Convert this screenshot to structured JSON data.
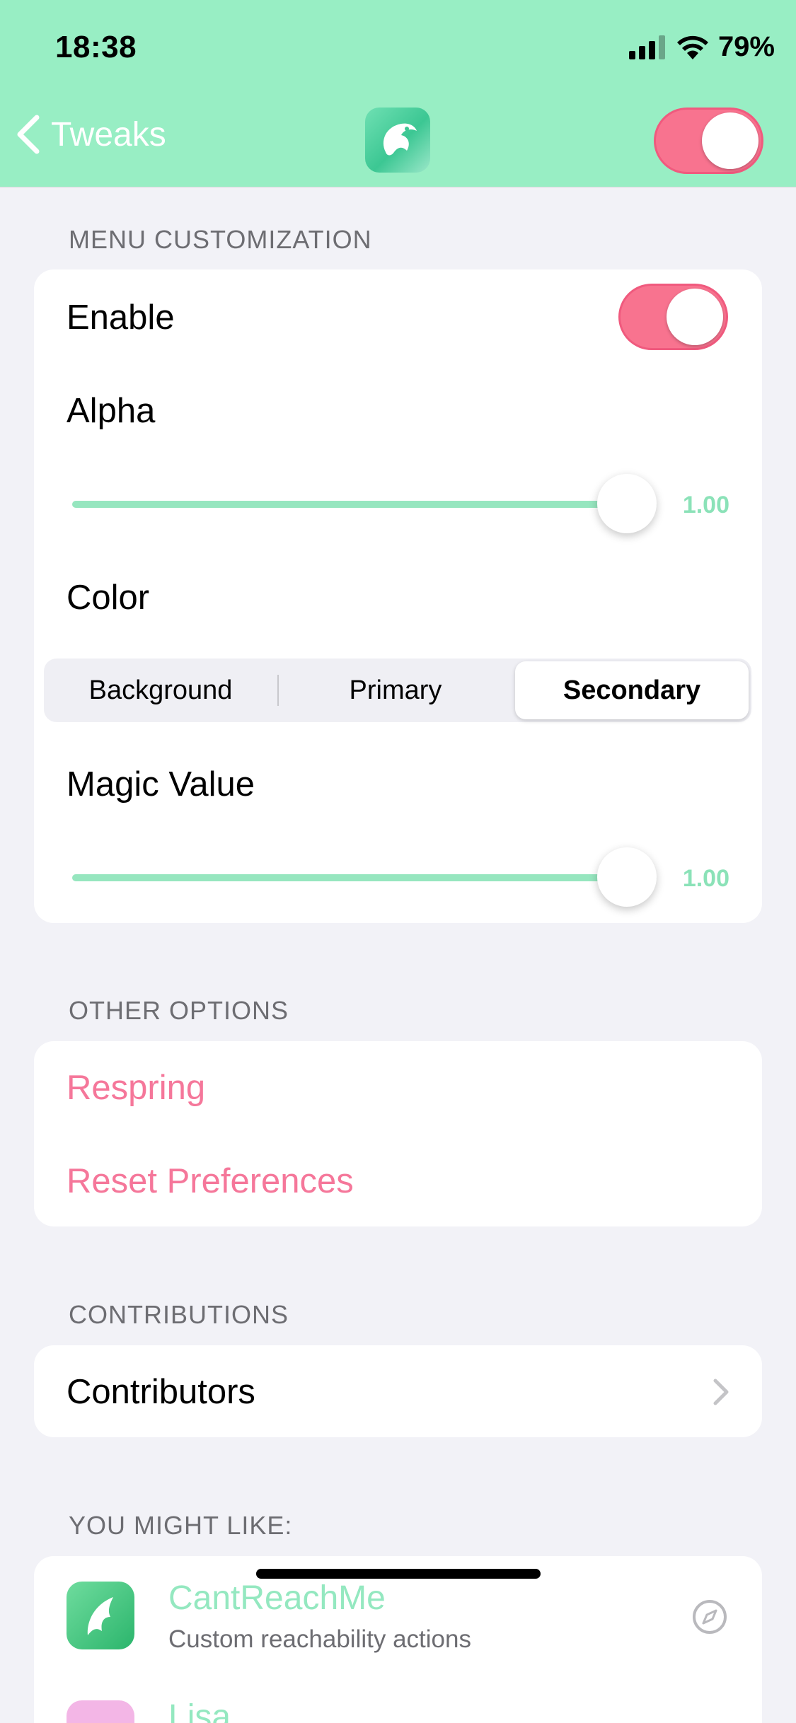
{
  "status_bar": {
    "time": "18:38",
    "battery": "79%"
  },
  "nav": {
    "back_label": "Tweaks",
    "enabled": true,
    "accent_color": "#98eec4",
    "toggle_color": "#f8738f"
  },
  "menu_customization": {
    "title": "MENU CUSTOMIZATION",
    "enable_label": "Enable",
    "enable_on": true,
    "alpha": {
      "label": "Alpha",
      "value": 1.0,
      "value_text": "1.00"
    },
    "color": {
      "label": "Color",
      "segments": [
        "Background",
        "Primary",
        "Secondary"
      ],
      "selected": "Secondary"
    },
    "magic_value": {
      "label": "Magic Value",
      "value": 1.0,
      "value_text": "1.00"
    }
  },
  "other_options": {
    "title": "OTHER OPTIONS",
    "respring_label": "Respring",
    "reset_label": "Reset Preferences"
  },
  "contributions": {
    "title": "CONTRIBUTIONS",
    "contributors_label": "Contributors"
  },
  "you_might_like": {
    "title": "YOU MIGHT LIKE:",
    "items": [
      {
        "name": "CantReachMe",
        "description": "Custom reachability actions",
        "icon": "cantreachme-app-icon"
      },
      {
        "name": "Lisa",
        "description": "",
        "icon": "lisa-app-icon"
      }
    ]
  }
}
